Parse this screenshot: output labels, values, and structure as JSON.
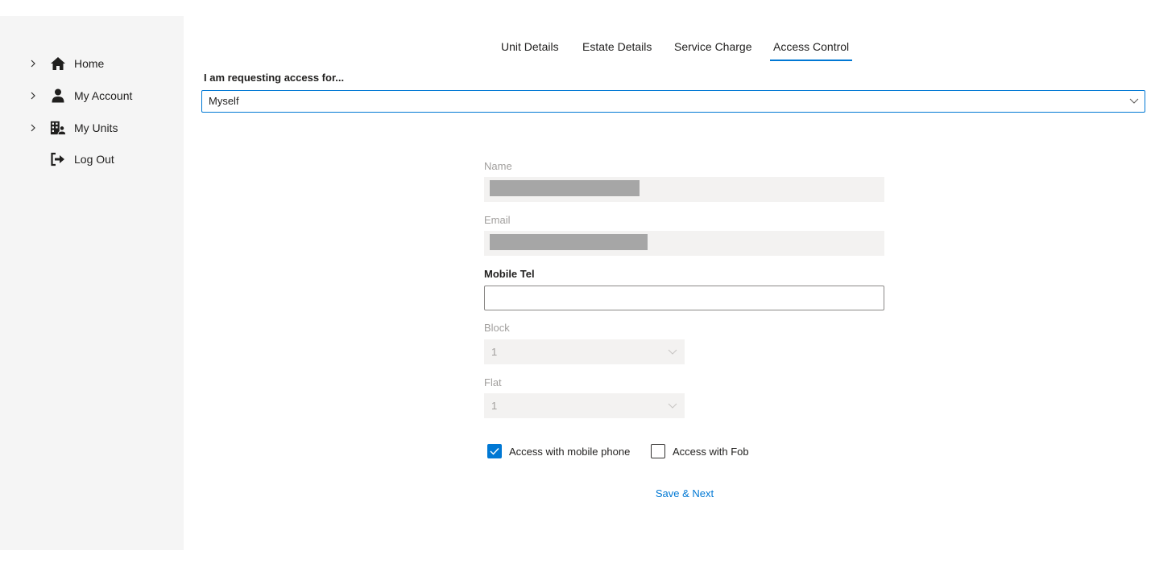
{
  "sidebar": {
    "items": [
      {
        "label": "Home",
        "icon": "home-icon",
        "has_chevron": true
      },
      {
        "label": "My Account",
        "icon": "person-icon",
        "has_chevron": true
      },
      {
        "label": "My Units",
        "icon": "building-person-icon",
        "has_chevron": true
      },
      {
        "label": "Log Out",
        "icon": "logout-icon",
        "has_chevron": false
      }
    ]
  },
  "tabs": [
    {
      "label": "Unit Details",
      "active": false
    },
    {
      "label": "Estate Details",
      "active": false
    },
    {
      "label": "Service Charge",
      "active": false
    },
    {
      "label": "Access Control",
      "active": true
    }
  ],
  "request": {
    "label": "I am requesting access for...",
    "selected": "Myself"
  },
  "form": {
    "name_label": "Name",
    "name_value": "",
    "email_label": "Email",
    "email_value": "",
    "mobile_label": "Mobile Tel",
    "mobile_value": "",
    "block_label": "Block",
    "block_value": "1",
    "flat_label": "Flat",
    "flat_value": "1",
    "access_mobile_label": "Access with mobile phone",
    "access_mobile_checked": true,
    "access_fob_label": "Access with Fob",
    "access_fob_checked": false,
    "save_label": "Save & Next"
  },
  "colors": {
    "accent": "#0078d4",
    "sidebar_bg": "#f5f5f5",
    "disabled_bg": "#f3f2f1",
    "redaction": "#a6a6a6"
  }
}
